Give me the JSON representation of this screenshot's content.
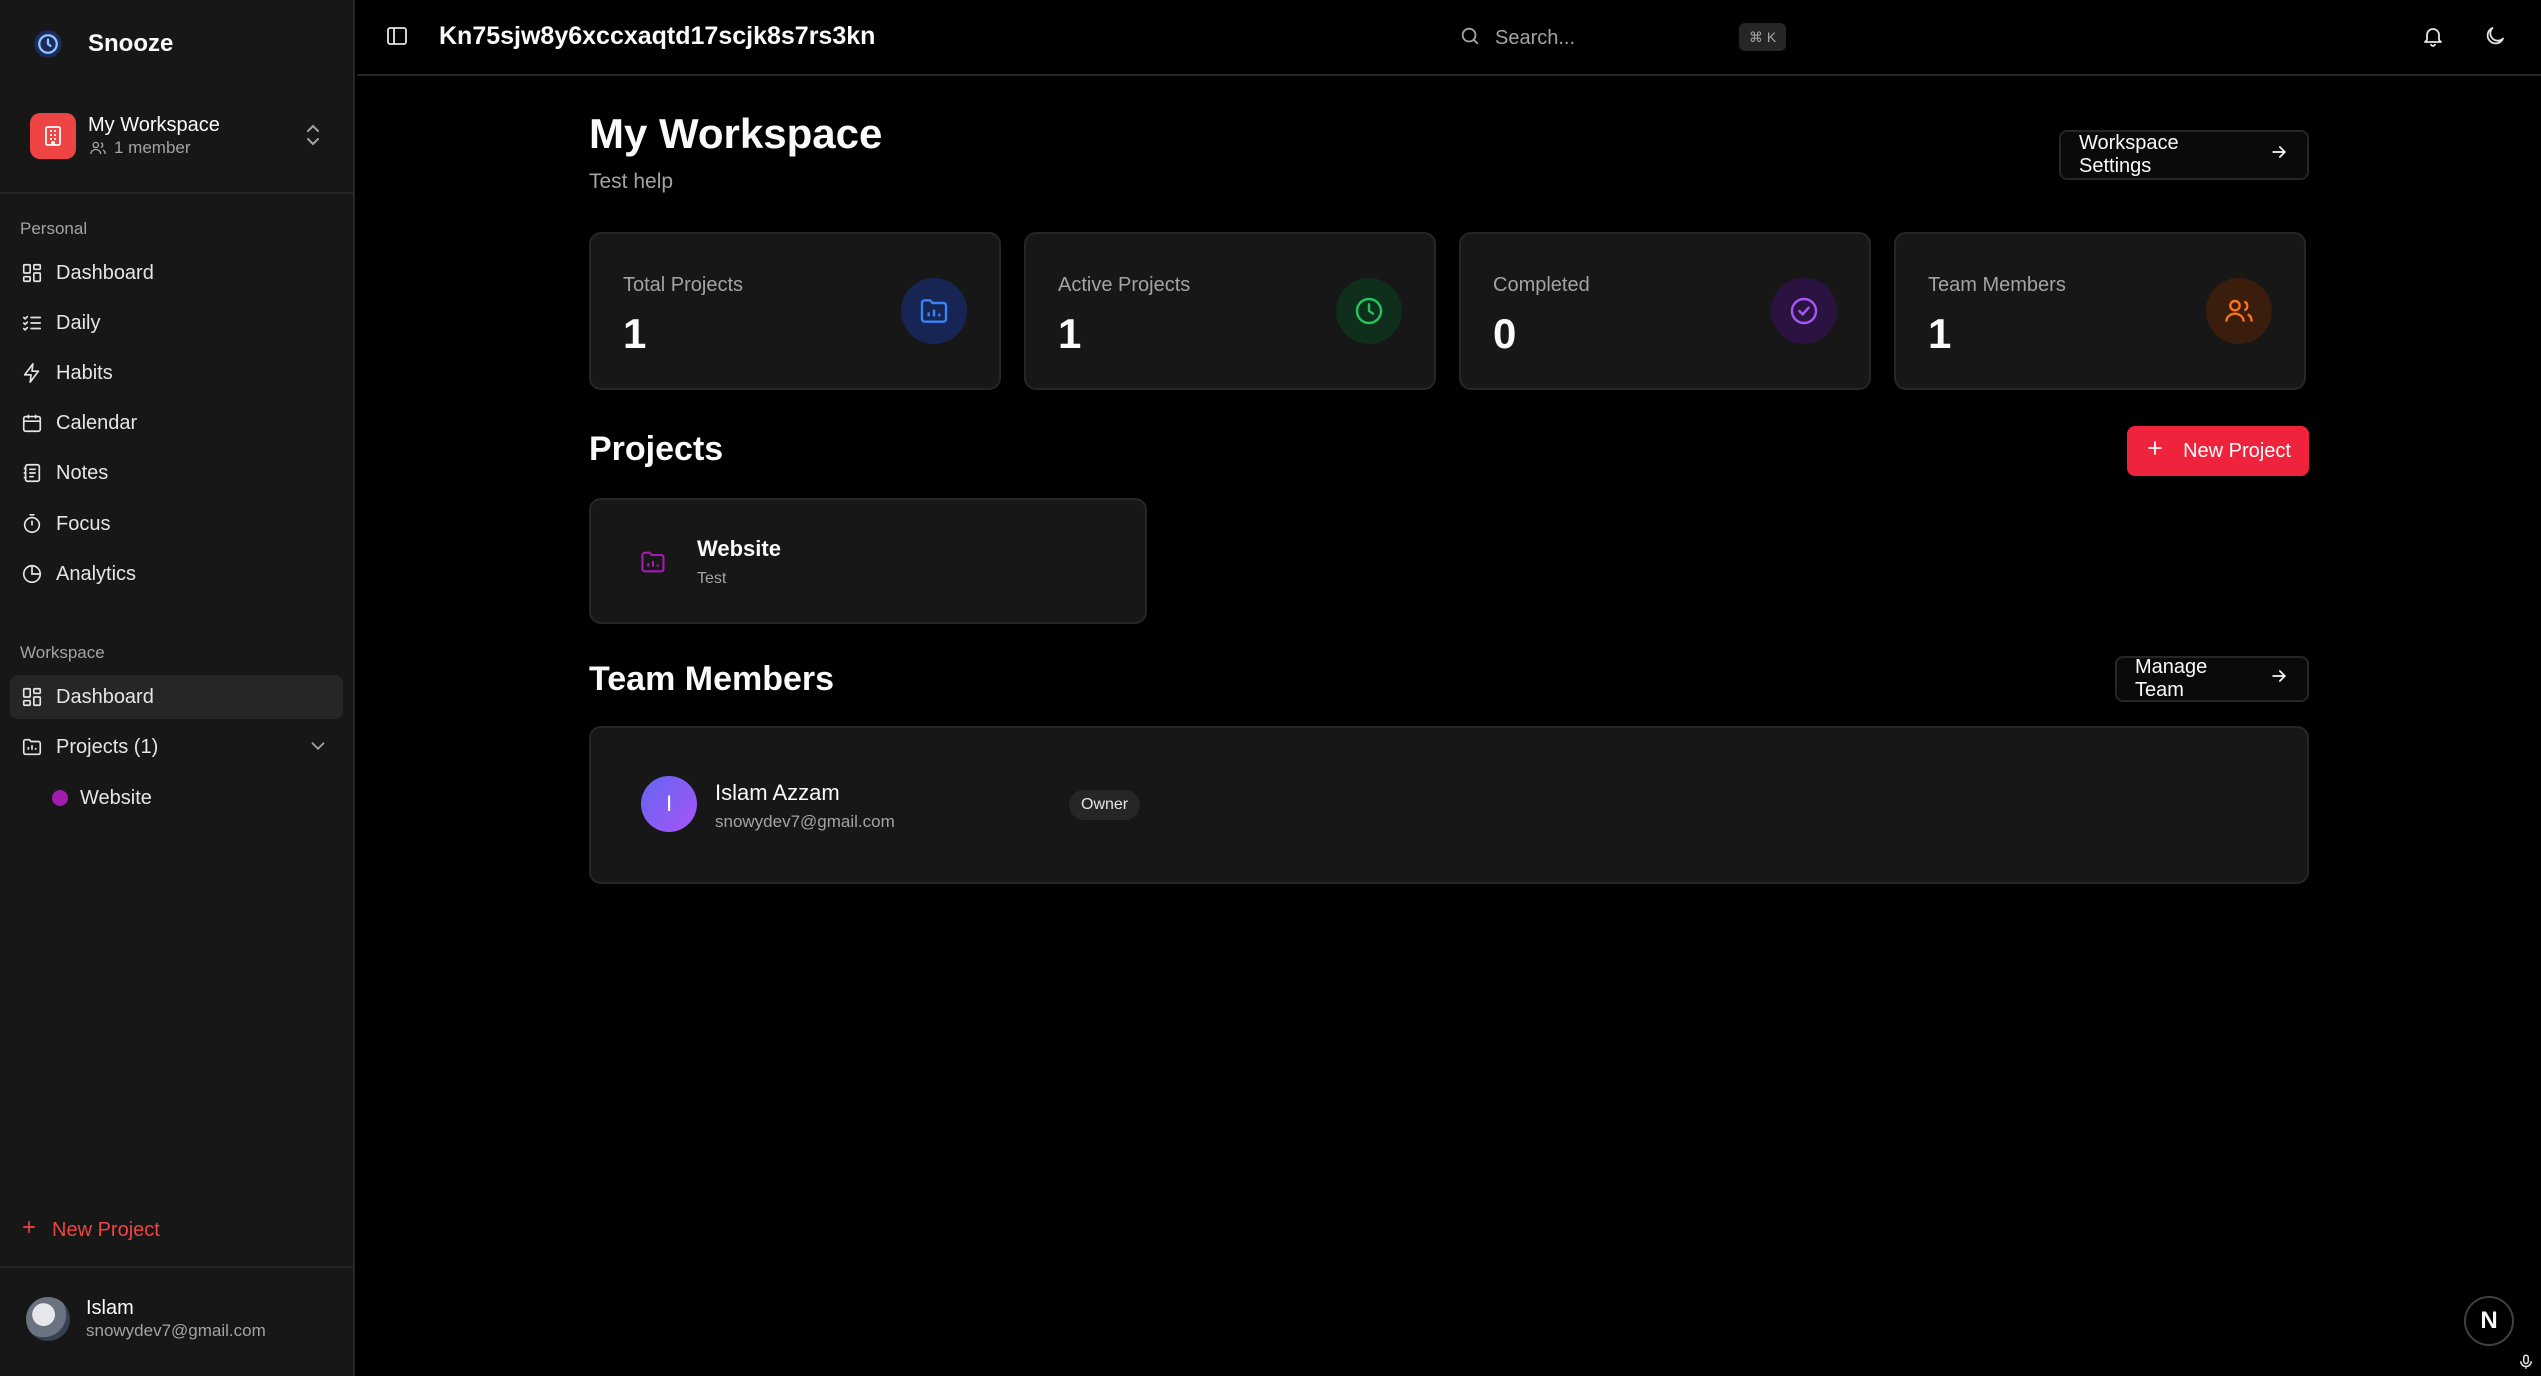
{
  "app": {
    "name": "Snooze"
  },
  "workspace_switcher": {
    "name": "My Workspace",
    "members": "1 member"
  },
  "sidebar": {
    "personal_label": "Personal",
    "personal_items": [
      {
        "label": "Dashboard",
        "icon": "grid-icon"
      },
      {
        "label": "Daily",
        "icon": "list-check-icon"
      },
      {
        "label": "Habits",
        "icon": "bolt-icon"
      },
      {
        "label": "Calendar",
        "icon": "calendar-icon"
      },
      {
        "label": "Notes",
        "icon": "notes-icon"
      },
      {
        "label": "Focus",
        "icon": "timer-icon"
      },
      {
        "label": "Analytics",
        "icon": "pie-chart-icon"
      }
    ],
    "workspace_label": "Workspace",
    "workspace_items": [
      {
        "label": "Dashboard",
        "icon": "grid-icon",
        "active": true
      },
      {
        "label": "Projects (1)",
        "icon": "folder-icon"
      }
    ],
    "projects": [
      {
        "label": "Website",
        "color": "#a21caf"
      }
    ],
    "new_project": "New Project",
    "user": {
      "name": "Islam",
      "email": "snowydev7@gmail.com"
    }
  },
  "topbar": {
    "page_id": "Kn75sjw8y6xccxaqtd17scjk8s7rs3kn",
    "search_placeholder": "Search...",
    "search_shortcut": "⌘ K"
  },
  "main": {
    "title": "My Workspace",
    "subtitle": "Test help",
    "settings_button": "Workspace Settings",
    "stats": [
      {
        "label": "Total Projects",
        "value": "1",
        "icon": "folder-chart-icon",
        "color": "#3b82f6",
        "bg": "#172554"
      },
      {
        "label": "Active Projects",
        "value": "1",
        "icon": "clock-icon",
        "color": "#22c55e",
        "bg": "#0f2e1c"
      },
      {
        "label": "Completed",
        "value": "0",
        "icon": "check-circle-icon",
        "color": "#a855f7",
        "bg": "#2a1340"
      },
      {
        "label": "Team Members",
        "value": "1",
        "icon": "users-icon",
        "color": "#f97316",
        "bg": "#3a1d0c"
      }
    ],
    "projects_title": "Projects",
    "new_project_button": "New Project",
    "projects": [
      {
        "name": "Website",
        "description": "Test"
      }
    ],
    "team_title": "Team Members",
    "manage_team_button": "Manage Team",
    "members": [
      {
        "initial": "I",
        "name": "Islam Azzam",
        "email": "snowydev7@gmail.com",
        "role": "Owner"
      }
    ]
  },
  "floating": {
    "n_label": "N"
  },
  "accent": "#ef233c"
}
